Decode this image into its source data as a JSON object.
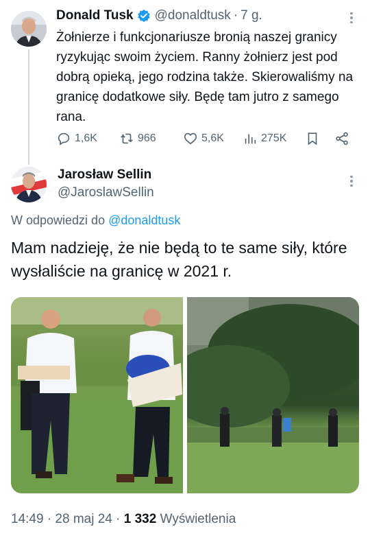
{
  "tweet": {
    "author_name": "Donald Tusk",
    "author_handle": "@donaldtusk",
    "separator": "·",
    "time": "7 g.",
    "text": "Żołnierze i funkcjonariusze bronią naszej granicy ryzykując swoim życiem. Ranny żołnierz jest pod dobrą opieką, jego rodzina także. Skierowaliśmy na granicę dodatkowe siły. Będę tam jutro z samego rana.",
    "stats": {
      "replies": "1,6K",
      "reposts": "966",
      "likes": "5,6K",
      "views": "275K"
    }
  },
  "reply": {
    "author_name": "Jarosław Sellin",
    "author_handle": "@JaroslawSellin",
    "reply_prefix": "W odpowiedzi do",
    "reply_to": "@donaldtusk",
    "text": "Mam nadzieję, że nie będą to te same siły, które wysłaliście na granicę w 2021 r.",
    "timestamp_prefix": "14:49 · 28 maj 24 ·",
    "views_count": "1 332",
    "views_label": "Wyświetlenia"
  },
  "colors": {
    "accent": "#1d9bf0",
    "secondary_text": "#536471",
    "primary_text": "#0f1419",
    "verified_badge": "#1d9bf0"
  },
  "icons": [
    "reply-icon",
    "repost-icon",
    "like-icon",
    "views-icon",
    "bookmark-icon",
    "share-icon",
    "more-icon",
    "verified-badge-icon"
  ]
}
